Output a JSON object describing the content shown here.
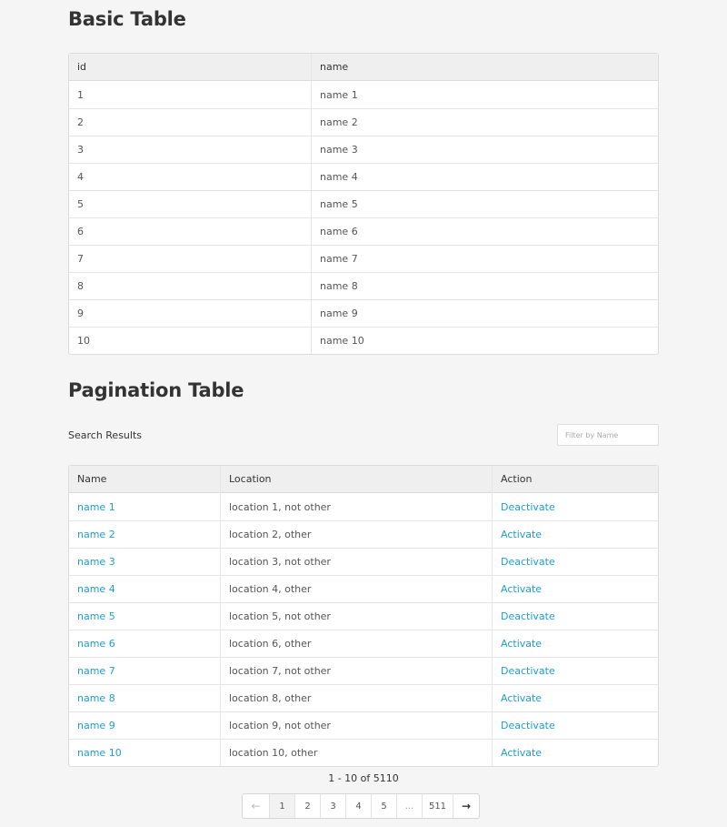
{
  "basic": {
    "title": "Basic Table",
    "columns": [
      "id",
      "name"
    ],
    "rows": [
      [
        "1",
        "name 1"
      ],
      [
        "2",
        "name 2"
      ],
      [
        "3",
        "name 3"
      ],
      [
        "4",
        "name 4"
      ],
      [
        "5",
        "name 5"
      ],
      [
        "6",
        "name 6"
      ],
      [
        "7",
        "name 7"
      ],
      [
        "8",
        "name 8"
      ],
      [
        "9",
        "name 9"
      ],
      [
        "10",
        "name 10"
      ]
    ]
  },
  "pagination": {
    "title": "Pagination Table",
    "search_label": "Search Results",
    "filter_placeholder": "Filter by Name",
    "columns": [
      "Name",
      "Location",
      "Action"
    ],
    "rows": [
      [
        "name 1",
        "location 1, not other",
        "Deactivate"
      ],
      [
        "name 2",
        "location 2, other",
        "Activate"
      ],
      [
        "name 3",
        "location 3, not other",
        "Deactivate"
      ],
      [
        "name 4",
        "location 4, other",
        "Activate"
      ],
      [
        "name 5",
        "location 5, not other",
        "Deactivate"
      ],
      [
        "name 6",
        "location 6, other",
        "Activate"
      ],
      [
        "name 7",
        "location 7, not other",
        "Deactivate"
      ],
      [
        "name 8",
        "location 8, other",
        "Activate"
      ],
      [
        "name 9",
        "location 9, not other",
        "Deactivate"
      ],
      [
        "name 10",
        "location 10, other",
        "Activate"
      ]
    ],
    "range_text": "1 - 10 of 5110",
    "pager": {
      "prev": "←",
      "pages": [
        "1",
        "2",
        "3",
        "4",
        "5"
      ],
      "ellipsis": "...",
      "last": "511",
      "next": "→",
      "active": "1"
    }
  },
  "colors": {
    "link": "#1b9ed3",
    "background": "#f5f5f5",
    "header": "#efefef"
  }
}
